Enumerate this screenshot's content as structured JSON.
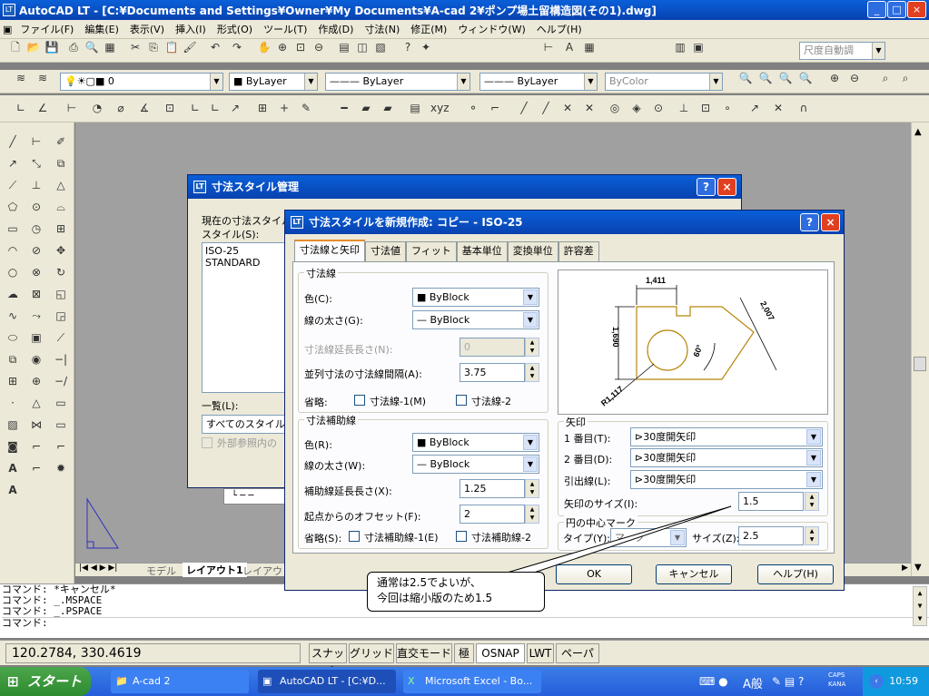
{
  "app": {
    "title": "AutoCAD LT - [C:¥Documents and Settings¥Owner¥My Documents¥A-cad 2¥ポンプ場土留構造図(その1).dwg]",
    "icon_label": "LT"
  },
  "menu": [
    "ファイル(F)",
    "編集(E)",
    "表示(V)",
    "挿入(I)",
    "形式(O)",
    "ツール(T)",
    "作成(D)",
    "寸法(N)",
    "修正(M)",
    "ウィンドウ(W)",
    "ヘルプ(H)"
  ],
  "toolbar": {
    "dimstyle_combo": "尺度自動調",
    "layer_combo": "0",
    "color_combo": "ByLayer",
    "linetype_combo": "ByLayer",
    "lineweight_combo": "ByLayer",
    "plotstyle_combo": "ByColor"
  },
  "layout_tabs": [
    "モデル",
    "レイアウト1",
    "レイアウト2"
  ],
  "command_lines": [
    "コマンド: *キャンセル*",
    "コマンド: _.MSPACE",
    "コマンド: _.PSPACE",
    "コマンド:"
  ],
  "status": {
    "coords": "120.2784, 330.4619",
    "buttons": [
      "スナップ",
      "グリッド",
      "直交モード",
      "極",
      "OSNAP",
      "LWT",
      "ペーパー"
    ]
  },
  "taskbar": {
    "start": "スタート",
    "tasks": [
      "A-cad 2",
      "AutoCAD LT - [C:¥D...",
      "Microsoft Excel - Bo..."
    ],
    "ime": "A般",
    "caps": "CAPS",
    "kana": "KANA",
    "clock": "10:59"
  },
  "dimstyle_manager": {
    "title": "寸法スタイル管理",
    "current_label": "現在の寸法スタイル",
    "styles_label": "スタイル(S):",
    "styles": [
      "ISO-25",
      "STANDARD"
    ],
    "list_label": "一覧(L):",
    "list_value": "すべてのスタイル",
    "xref_label": "外部参照内の"
  },
  "new_style": {
    "title": "寸法スタイルを新規作成: コピー - ISO-25",
    "tabs": [
      "寸法線と矢印",
      "寸法値",
      "フィット",
      "基本単位",
      "変換単位",
      "許容差"
    ],
    "dimline": {
      "group": "寸法線",
      "color_label": "色(C):",
      "color_value": "ByBlock",
      "lw_label": "線の太さ(G):",
      "lw_value": "ByBlock",
      "ext_label": "寸法線延長長さ(N):",
      "ext_value": "0",
      "spacing_label": "並列寸法の寸法線間隔(A):",
      "spacing_value": "3.75",
      "suppress_label": "省略:",
      "suppress1": "寸法線-1(M)",
      "suppress2": "寸法線-2"
    },
    "extline": {
      "group": "寸法補助線",
      "color_label": "色(R):",
      "color_value": "ByBlock",
      "lw_label": "線の太さ(W):",
      "lw_value": "ByBlock",
      "ext_label": "補助線延長長さ(X):",
      "ext_value": "1.25",
      "offset_label": "起点からのオフセット(F):",
      "offset_value": "2",
      "suppress_label": "省略(S):",
      "suppress1": "寸法補助線-1(E)",
      "suppress2": "寸法補助線-2"
    },
    "arrows": {
      "group": "矢印",
      "first_label": "1 番目(T):",
      "first_value": "30度開矢印",
      "second_label": "2 番目(D):",
      "second_value": "30度開矢印",
      "leader_label": "引出線(L):",
      "leader_value": "30度開矢印",
      "size_label": "矢印のサイズ(I):",
      "size_value": "1.5"
    },
    "center": {
      "group": "円の中心マーク",
      "type_label": "タイプ(Y):",
      "type_value": "マーク",
      "size_label": "サイズ(Z):",
      "size_value": "2.5"
    },
    "preview": {
      "dim_top": "1,411",
      "dim_left": "1,690",
      "dim_right": "2,007",
      "dim_angle": "60°",
      "dim_radius": "R1,117"
    },
    "ok": "OK",
    "cancel": "キャンセル",
    "help": "ヘルプ(H)"
  },
  "callout": {
    "line1": "通常は2.5でよいが、",
    "line2": "今回は縮小版のため1.5"
  },
  "colors": {
    "accent": "#0842b0",
    "preview_line": "#b8860b"
  }
}
